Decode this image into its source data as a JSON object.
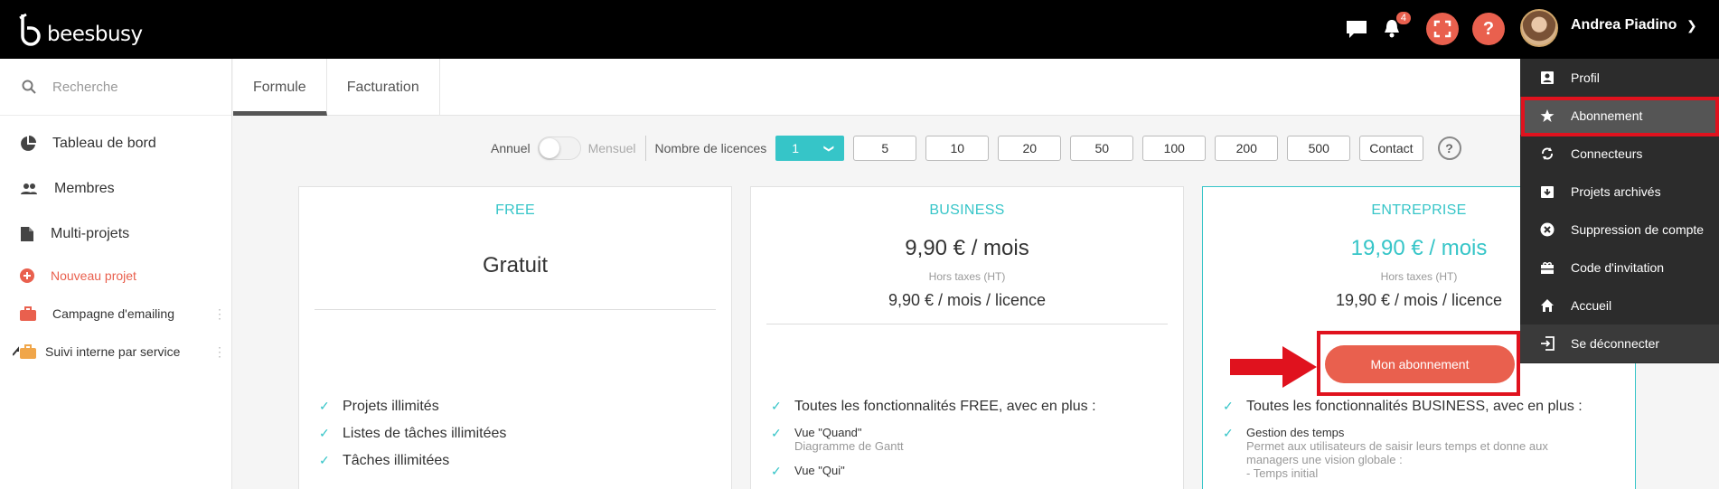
{
  "app": {
    "logo_text": "beesbusy"
  },
  "topbar": {
    "notification_count": "4",
    "help_glyph": "?",
    "user_name": "Andrea Piadino",
    "icons": [
      "chat-icon",
      "bell-icon",
      "fullscreen-icon",
      "help-icon",
      "chevron-down-icon"
    ]
  },
  "sidebar": {
    "search_placeholder": "Recherche",
    "items": [
      {
        "label": "Tableau de bord",
        "icon": "pie-chart-icon"
      },
      {
        "label": "Membres",
        "icon": "users-icon"
      },
      {
        "label": "Multi-projets",
        "icon": "document-icon"
      },
      {
        "label": "Nouveau projet",
        "icon": "plus-circle-icon"
      },
      {
        "label": "Campagne d'emailing",
        "icon": "briefcase-icon"
      },
      {
        "label": "Suivi interne par service",
        "icon": "shared-briefcase-icon"
      }
    ]
  },
  "tabs": [
    {
      "label": "Formule"
    },
    {
      "label": "Facturation"
    }
  ],
  "controls": {
    "annual_label": "Annuel",
    "monthly_label": "Mensuel",
    "licences_label": "Nombre de licences",
    "selected_licences": "1",
    "licence_options": [
      "5",
      "10",
      "20",
      "50",
      "100",
      "200",
      "500"
    ],
    "contact_label": "Contact",
    "help_glyph": "?"
  },
  "plans": {
    "free": {
      "name": "FREE",
      "price": "Gratuit",
      "features": [
        "Projets illimités",
        "Listes de tâches illimitées",
        "Tâches illimitées"
      ]
    },
    "business": {
      "name": "BUSINESS",
      "price": "9,90 € / mois",
      "tax_note": "Hors taxes (HT)",
      "per_licence": "9,90 € / mois / licence",
      "features_intro": "Toutes les fonctionnalités FREE, avec en plus :",
      "feat1_title": "Vue \"Quand\"",
      "feat1_desc": "Diagramme de Gantt",
      "feat2_title": "Vue \"Qui\""
    },
    "entreprise": {
      "name": "ENTREPRISE",
      "price": "19,90 € / mois",
      "tax_note": "Hors taxes (HT)",
      "per_licence": "19,90 € / mois / licence",
      "button": "Mon abonnement",
      "features_intro": "Toutes les fonctionnalités BUSINESS, avec en plus :",
      "feat1_title": "Gestion des temps",
      "feat1_desc_line1": "Permet aux utilisateurs de saisir leurs temps et donne aux",
      "feat1_desc_line2": "managers une vision globale :",
      "feat1_desc_line3": "- Temps initial"
    }
  },
  "user_menu": {
    "items": [
      {
        "label": "Profil",
        "icon": "profile-icon"
      },
      {
        "label": "Abonnement",
        "icon": "star-icon"
      },
      {
        "label": "Connecteurs",
        "icon": "sync-icon"
      },
      {
        "label": "Projets archivés",
        "icon": "archive-icon"
      },
      {
        "label": "Suppression de compte",
        "icon": "close-circle-icon"
      },
      {
        "label": "Code d'invitation",
        "icon": "gift-icon"
      },
      {
        "label": "Accueil",
        "icon": "home-icon"
      },
      {
        "label": "Se déconnecter",
        "icon": "logout-icon"
      }
    ]
  },
  "colors": {
    "teal": "#36c5c8",
    "coral": "#e9604e",
    "highlight_red": "#e0121e"
  }
}
